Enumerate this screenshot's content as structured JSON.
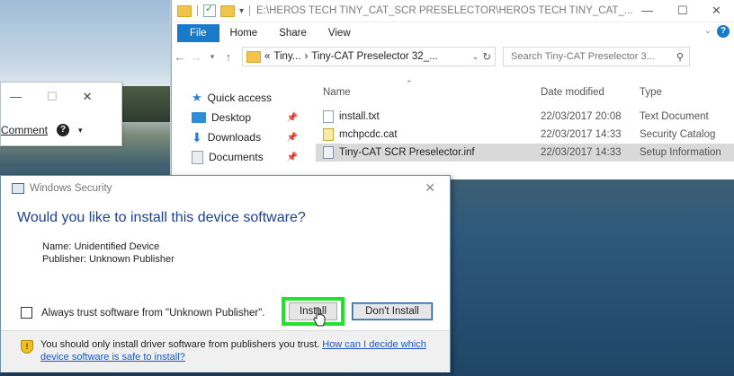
{
  "explorer": {
    "title": "E:\\HEROS TECH TINY_CAT_SCR PRESELECTOR\\HEROS TECH TINY_CAT_...",
    "window_controls": {
      "minimize": "—",
      "maximize": "☐",
      "close": "✕"
    },
    "ribbon_tabs": [
      "File",
      "Home",
      "Share",
      "View"
    ],
    "address": {
      "segments": [
        "«",
        "Tiny...",
        "›",
        "Tiny-CAT Preselector 32_..."
      ]
    },
    "search_placeholder": "Search Tiny-CAT Preselector 3...",
    "nav_pane": [
      {
        "label": "Quick access",
        "icon": "star-icon",
        "pinned": false
      },
      {
        "label": "Desktop",
        "icon": "desktop-icon",
        "pinned": true
      },
      {
        "label": "Downloads",
        "icon": "download-icon",
        "pinned": true
      },
      {
        "label": "Documents",
        "icon": "documents-icon",
        "pinned": true
      }
    ],
    "columns": {
      "name": "Name",
      "date": "Date modified",
      "type": "Type"
    },
    "files": [
      {
        "name": "install.txt",
        "date": "22/03/2017 20:08",
        "type": "Text Document",
        "selected": false
      },
      {
        "name": "mchpcdc.cat",
        "date": "22/03/2017 14:33",
        "type": "Security Catalog",
        "selected": false
      },
      {
        "name": "Tiny-CAT SCR Preselector.inf",
        "date": "22/03/2017 14:33",
        "type": "Setup Information",
        "selected": true
      }
    ]
  },
  "small_window": {
    "controls": {
      "minimize": "—",
      "maximize": "☐",
      "close": "✕"
    },
    "comment_label": "Comment"
  },
  "dialog": {
    "title": "Windows Security",
    "question": "Would you like to install this device software?",
    "name_line": "Name: Unidentified Device",
    "publisher_line": "Publisher: Unknown Publisher",
    "trust_label": "Always trust software from \"Unknown Publisher\".",
    "install_label": "Install",
    "dont_install_label": "Don't Install",
    "footer_text": "You should only install driver software from publishers you trust.",
    "footer_link": "How can I decide which device software is safe to install?",
    "highlight_color": "#22e22b"
  }
}
